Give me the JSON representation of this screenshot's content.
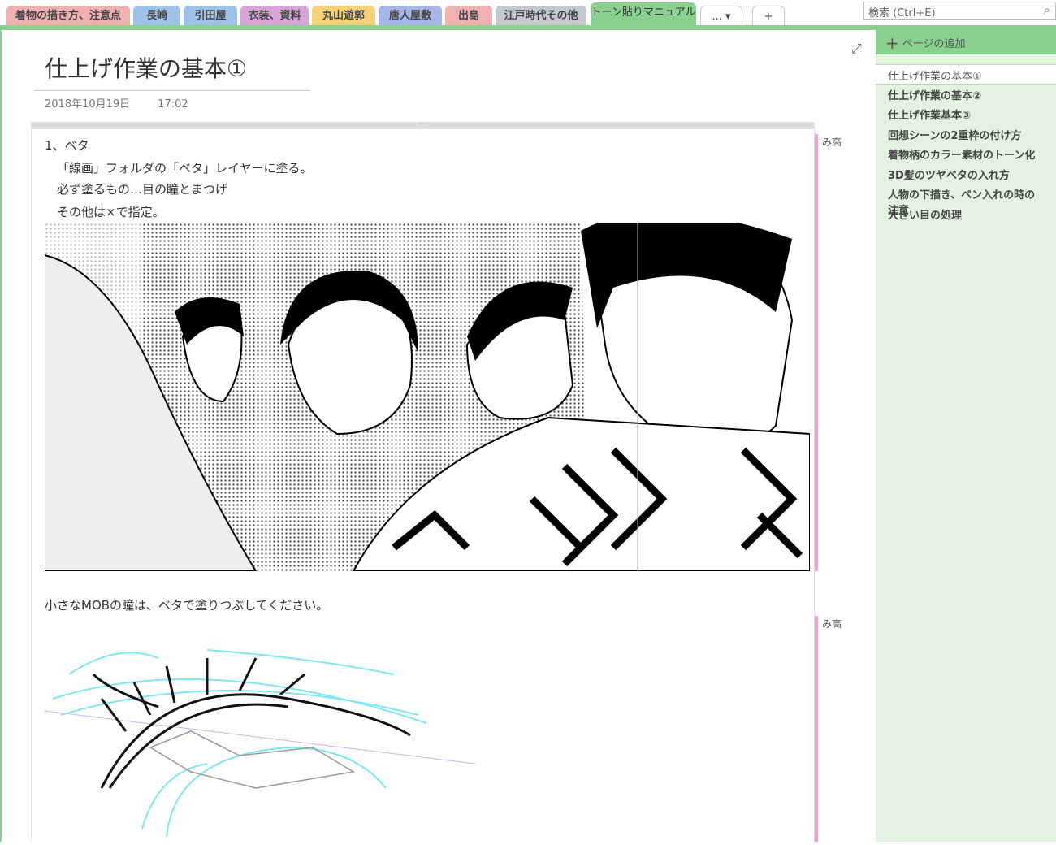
{
  "tabs": [
    {
      "label": "着物の描き方、注意点",
      "color": "#f2b1b1"
    },
    {
      "label": "長崎",
      "color": "#9fc3e8"
    },
    {
      "label": "引田屋",
      "color": "#9fc3e8"
    },
    {
      "label": "衣装、資料",
      "color": "#d7a6d6"
    },
    {
      "label": "丸山遊郭",
      "color": "#f3d27a"
    },
    {
      "label": "唐人屋敷",
      "color": "#a6b6e6"
    },
    {
      "label": "出島",
      "color": "#f2b1b1"
    },
    {
      "label": "江戸時代その他",
      "color": "#c5c8cc"
    },
    {
      "label": "トーン貼りマニュアル",
      "color": "#8ad18f"
    }
  ],
  "more_label": "... ▾",
  "add_tab_label": "+",
  "search": {
    "placeholder": "検索 (Ctrl+E)",
    "icon": "search-icon"
  },
  "page": {
    "title": "仕上げ作業の基本①",
    "date": "2018年10月19日",
    "time": "17:02",
    "lines": [
      "1、ベタ",
      "「線画」フォルダの「ベタ」レイヤーに塗る。",
      "必ず塗るもの…目の瞳とまつげ",
      "その他は×で指定。"
    ],
    "caption2": "小さなMOBの瞳は、ベタで塗りつぶしてください。",
    "author_tag": "み高"
  },
  "sidebar": {
    "add_page": "ページの追加",
    "pages": [
      "仕上げ作業の基本①",
      "仕上げ作業の基本②",
      "仕上げ作業基本③",
      "回想シーンの2重枠の付け方",
      "着物柄のカラー素材のトーン化",
      "3D髪のツヤベタの入れ方",
      "人物の下描き、ペン入れの時の注意",
      "大きい目の処理"
    ],
    "selected": 0
  }
}
